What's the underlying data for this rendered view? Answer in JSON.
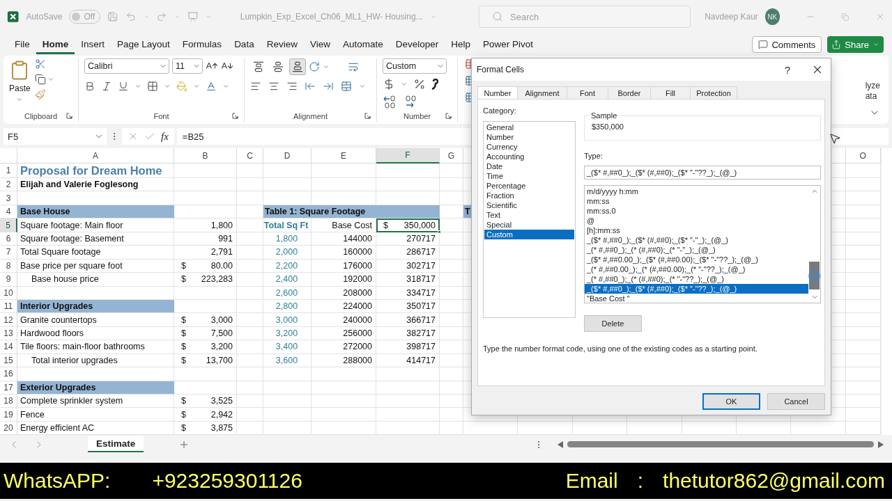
{
  "title_bar": {
    "autosave_label": "AutoSave",
    "autosave": {
      "on": false,
      "label": "Off"
    },
    "file_name": "Lumpkin_Exp_Excel_Ch06_ML1_HW- Housing...",
    "search": {
      "placeholder": "Search"
    },
    "user_name": "Navdeep Kaur",
    "avatar_initials": "NK"
  },
  "menu": [
    {
      "label": "File",
      "selected": false
    },
    {
      "label": "Home",
      "selected": true
    },
    {
      "label": "Insert",
      "selected": false
    },
    {
      "label": "Page Layout",
      "selected": false
    },
    {
      "label": "Formulas",
      "selected": false
    },
    {
      "label": "Data",
      "selected": false
    },
    {
      "label": "Review",
      "selected": false
    },
    {
      "label": "View",
      "selected": false
    },
    {
      "label": "Automate",
      "selected": false
    },
    {
      "label": "Developer",
      "selected": false
    },
    {
      "label": "Help",
      "selected": false
    },
    {
      "label": "Power Pivot",
      "selected": false
    }
  ],
  "comments_button": "Comments",
  "share_button": "Share",
  "ribbon": {
    "groups": [
      {
        "kind": "clipboard",
        "label": "Clipboard",
        "paste_label": "Paste"
      },
      {
        "kind": "font",
        "label": "Font",
        "font_name": "Calibri",
        "font_size": "11"
      },
      {
        "kind": "alignment",
        "label": "Alignment"
      },
      {
        "kind": "number",
        "label": "Number",
        "format": "Custom"
      }
    ],
    "analyze_label": [
      "lyze",
      "ata"
    ]
  },
  "formula_bar": {
    "name_box": "F5",
    "fx_label": "fx",
    "formula": "=B25"
  },
  "sheet": {
    "columns": [
      {
        "label": "A",
        "selected": false
      },
      {
        "label": "B",
        "selected": false
      },
      {
        "label": "C",
        "selected": false
      },
      {
        "label": "D",
        "selected": false
      },
      {
        "label": "E",
        "selected": false
      },
      {
        "label": "F",
        "selected": true
      },
      {
        "label": "G",
        "selected": false
      }
    ],
    "right_column": "O",
    "rows": [
      {
        "number": "1",
        "selected": false,
        "cells": {
          "a": {
            "text": "Proposal for Dream Home",
            "kind": "title",
            "selected": false
          }
        }
      },
      {
        "number": "2",
        "selected": false,
        "cells": {
          "a": {
            "text": "Elijah and Valerie Foglesong",
            "kind": "bold",
            "selected": false
          }
        }
      },
      {
        "number": "3",
        "selected": false,
        "cells": {}
      },
      {
        "number": "4",
        "selected": false,
        "cells": {
          "a": {
            "text": "Base House",
            "kind": "section",
            "selected": false
          },
          "d": {
            "text": "Table 1: Square Footage",
            "kind": "table-title",
            "selected": false
          },
          "h": {
            "text": "T",
            "kind": "table-title",
            "selected": false
          }
        }
      },
      {
        "number": "5",
        "selected": true,
        "cells": {
          "a": {
            "text": "Square footage: Main floor",
            "kind": "text",
            "selected": false
          },
          "b": {
            "text": "1,800",
            "kind": "number",
            "selected": false
          },
          "d": {
            "text": "Total Sq Ft",
            "kind": "teal-header",
            "selected": false
          },
          "e": {
            "text": "Base Cost",
            "kind": "number",
            "selected": false
          },
          "f": {
            "text": "350,000",
            "currency": "$",
            "kind": "number",
            "selected": true
          }
        }
      },
      {
        "number": "6",
        "selected": false,
        "cells": {
          "a": {
            "text": "Square footage: Basement",
            "kind": "text",
            "selected": false
          },
          "b": {
            "text": "991",
            "kind": "number",
            "selected": false
          },
          "d": {
            "text": "1,800",
            "kind": "teal",
            "selected": false
          },
          "e": {
            "text": "144000",
            "kind": "number",
            "selected": false
          },
          "f": {
            "text": "270717",
            "kind": "number",
            "selected": false
          }
        }
      },
      {
        "number": "7",
        "selected": false,
        "cells": {
          "a": {
            "text": "Total Square footage",
            "kind": "text",
            "selected": false
          },
          "b": {
            "text": "2,791",
            "kind": "number",
            "selected": false
          },
          "d": {
            "text": "2,000",
            "kind": "teal",
            "selected": false
          },
          "e": {
            "text": "160000",
            "kind": "number",
            "selected": false
          },
          "f": {
            "text": "286717",
            "kind": "number",
            "selected": false
          }
        }
      },
      {
        "number": "8",
        "selected": false,
        "cells": {
          "a": {
            "text": "Base price per square foot",
            "kind": "text",
            "selected": false
          },
          "b": {
            "text": "80.00",
            "currency": "$",
            "kind": "number",
            "selected": false
          },
          "d": {
            "text": "2,200",
            "kind": "teal",
            "selected": false
          },
          "e": {
            "text": "176000",
            "kind": "number",
            "selected": false
          },
          "f": {
            "text": "302717",
            "kind": "number",
            "selected": false
          }
        }
      },
      {
        "number": "9",
        "selected": false,
        "cells": {
          "a": {
            "text": "Base house price",
            "kind": "indent",
            "selected": false
          },
          "b": {
            "text": "223,283",
            "currency": "$",
            "kind": "number",
            "selected": false
          },
          "d": {
            "text": "2,400",
            "kind": "teal",
            "selected": false
          },
          "e": {
            "text": "192000",
            "kind": "number",
            "selected": false
          },
          "f": {
            "text": "318717",
            "kind": "number",
            "selected": false
          }
        }
      },
      {
        "number": "10",
        "selected": false,
        "cells": {
          "d": {
            "text": "2,600",
            "kind": "teal",
            "selected": false
          },
          "e": {
            "text": "208000",
            "kind": "number",
            "selected": false
          },
          "f": {
            "text": "334717",
            "kind": "number",
            "selected": false
          }
        }
      },
      {
        "number": "11",
        "selected": false,
        "cells": {
          "a": {
            "text": "Interior Upgrades",
            "kind": "section",
            "selected": false
          },
          "d": {
            "text": "2,800",
            "kind": "teal",
            "selected": false
          },
          "e": {
            "text": "224000",
            "kind": "number",
            "selected": false
          },
          "f": {
            "text": "350717",
            "kind": "number",
            "selected": false
          }
        }
      },
      {
        "number": "12",
        "selected": false,
        "cells": {
          "a": {
            "text": "Granite countertops",
            "kind": "text",
            "selected": false
          },
          "b": {
            "text": "3,000",
            "currency": "$",
            "kind": "number",
            "selected": false
          },
          "d": {
            "text": "3,000",
            "kind": "teal",
            "selected": false
          },
          "e": {
            "text": "240000",
            "kind": "number",
            "selected": false
          },
          "f": {
            "text": "366717",
            "kind": "number",
            "selected": false
          }
        }
      },
      {
        "number": "13",
        "selected": false,
        "cells": {
          "a": {
            "text": "Hardwood floors",
            "kind": "text",
            "selected": false
          },
          "b": {
            "text": "7,500",
            "currency": "$",
            "kind": "number",
            "selected": false
          },
          "d": {
            "text": "3,200",
            "kind": "teal",
            "selected": false
          },
          "e": {
            "text": "256000",
            "kind": "number",
            "selected": false
          },
          "f": {
            "text": "382717",
            "kind": "number",
            "selected": false
          }
        }
      },
      {
        "number": "14",
        "selected": false,
        "cells": {
          "a": {
            "text": "Tile floors: main-floor bathrooms",
            "kind": "text",
            "selected": false
          },
          "b": {
            "text": "3,200",
            "currency": "$",
            "kind": "number",
            "selected": false
          },
          "d": {
            "text": "3,400",
            "kind": "teal",
            "selected": false
          },
          "e": {
            "text": "272000",
            "kind": "number",
            "selected": false
          },
          "f": {
            "text": "398717",
            "kind": "number",
            "selected": false
          }
        }
      },
      {
        "number": "15",
        "selected": false,
        "cells": {
          "a": {
            "text": "Total interior upgrades",
            "kind": "indent",
            "selected": false
          },
          "b": {
            "text": "13,700",
            "currency": "$",
            "kind": "number",
            "selected": false
          },
          "d": {
            "text": "3,600",
            "kind": "teal",
            "selected": false
          },
          "e": {
            "text": "288000",
            "kind": "number",
            "selected": false
          },
          "f": {
            "text": "414717",
            "kind": "number",
            "selected": false
          }
        }
      },
      {
        "number": "16",
        "selected": false,
        "cells": {}
      },
      {
        "number": "17",
        "selected": false,
        "cells": {
          "a": {
            "text": "Exterior Upgrades",
            "kind": "section",
            "selected": false
          }
        }
      },
      {
        "number": "18",
        "selected": false,
        "cells": {
          "a": {
            "text": "Complete sprinkler system",
            "kind": "text",
            "selected": false
          },
          "b": {
            "text": "3,525",
            "currency": "$",
            "kind": "number",
            "selected": false
          }
        }
      },
      {
        "number": "19",
        "selected": false,
        "cells": {
          "a": {
            "text": "Fence",
            "kind": "text",
            "selected": false
          },
          "b": {
            "text": "2,942",
            "currency": "$",
            "kind": "number",
            "selected": false
          }
        }
      },
      {
        "number": "20",
        "selected": false,
        "cells": {
          "a": {
            "text": "Energy efficient AC",
            "kind": "text",
            "selected": false
          },
          "b": {
            "text": "3,875",
            "currency": "$",
            "kind": "number",
            "selected": false
          }
        }
      }
    ]
  },
  "sheet_tabs": [
    {
      "label": "Estimate",
      "selected": true
    }
  ],
  "dialog": {
    "title": "Format Cells",
    "help": "?",
    "tabs": [
      {
        "label": "Number",
        "selected": true
      },
      {
        "label": "Alignment",
        "selected": false
      },
      {
        "label": "Font",
        "selected": false
      },
      {
        "label": "Border",
        "selected": false
      },
      {
        "label": "Fill",
        "selected": false
      },
      {
        "label": "Protection",
        "selected": false
      }
    ],
    "category_label": "Category:",
    "categories": [
      {
        "label": "General",
        "selected": false
      },
      {
        "label": "Number",
        "selected": false
      },
      {
        "label": "Currency",
        "selected": false
      },
      {
        "label": "Accounting",
        "selected": false
      },
      {
        "label": "Date",
        "selected": false
      },
      {
        "label": "Time",
        "selected": false
      },
      {
        "label": "Percentage",
        "selected": false
      },
      {
        "label": "Fraction",
        "selected": false
      },
      {
        "label": "Scientific",
        "selected": false
      },
      {
        "label": "Text",
        "selected": false
      },
      {
        "label": "Special",
        "selected": false
      },
      {
        "label": "Custom",
        "selected": true
      }
    ],
    "sample_label": "Sample",
    "sample_value": "$350,000",
    "type_label": "Type:",
    "type_value": "_($* #,##0_);_($* (#,##0);_($* \"-\"??_);_(@_)",
    "types": [
      {
        "label": "m/d/yyyy h:mm",
        "selected": false
      },
      {
        "label": "mm:ss",
        "selected": false
      },
      {
        "label": "mm:ss.0",
        "selected": false
      },
      {
        "label": "@",
        "selected": false
      },
      {
        "label": "[h]:mm:ss",
        "selected": false
      },
      {
        "label": "_($* #,##0_);_($* (#,##0);_($* \"-\"_);_(@_)",
        "selected": false
      },
      {
        "label": "_(* #,##0_);_(* (#,##0);_(* \"-\"_);_(@_)",
        "selected": false
      },
      {
        "label": "_($* #,##0.00_);_($* (#,##0.00);_($* \"-\"??_);_(@_)",
        "selected": false
      },
      {
        "label": "_(* #,##0.00_);_(* (#,##0.00);_(* \"-\"??_);_(@_)",
        "selected": false
      },
      {
        "label": "_(* #,##0_);_(* (#,##0);_(* \"-\"??_);_(@_)",
        "selected": false
      },
      {
        "label": "_($* #,##0_);_($* (#,##0);_($* \"-\"??_);_(@_)",
        "selected": true
      },
      {
        "label": "\"Base Cost \"",
        "selected": false
      }
    ],
    "delete_button": "Delete",
    "hint": "Type the number format code, using one of the existing codes as a starting point.",
    "ok_button": "OK",
    "cancel_button": "Cancel"
  },
  "banner": {
    "whatsapp_label": "WhatsAPP:",
    "whatsapp_number": "+923259301126",
    "email_label": "Email",
    "email_separator": ":",
    "email": "thetutor862@gmail.com"
  }
}
